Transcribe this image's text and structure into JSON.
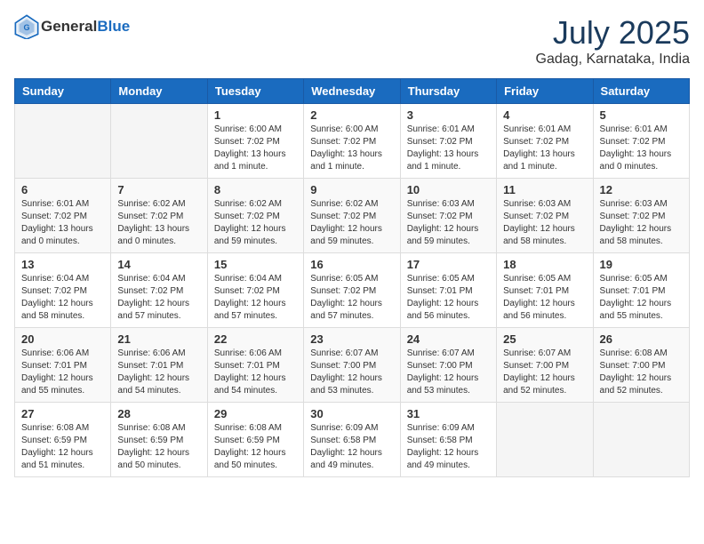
{
  "header": {
    "logo_general": "General",
    "logo_blue": "Blue",
    "month_year": "July 2025",
    "location": "Gadag, Karnataka, India"
  },
  "weekdays": [
    "Sunday",
    "Monday",
    "Tuesday",
    "Wednesday",
    "Thursday",
    "Friday",
    "Saturday"
  ],
  "weeks": [
    [
      {
        "day": "",
        "empty": true
      },
      {
        "day": "",
        "empty": true
      },
      {
        "day": "1",
        "sunrise": "Sunrise: 6:00 AM",
        "sunset": "Sunset: 7:02 PM",
        "daylight": "Daylight: 13 hours and 1 minute."
      },
      {
        "day": "2",
        "sunrise": "Sunrise: 6:00 AM",
        "sunset": "Sunset: 7:02 PM",
        "daylight": "Daylight: 13 hours and 1 minute."
      },
      {
        "day": "3",
        "sunrise": "Sunrise: 6:01 AM",
        "sunset": "Sunset: 7:02 PM",
        "daylight": "Daylight: 13 hours and 1 minute."
      },
      {
        "day": "4",
        "sunrise": "Sunrise: 6:01 AM",
        "sunset": "Sunset: 7:02 PM",
        "daylight": "Daylight: 13 hours and 1 minute."
      },
      {
        "day": "5",
        "sunrise": "Sunrise: 6:01 AM",
        "sunset": "Sunset: 7:02 PM",
        "daylight": "Daylight: 13 hours and 0 minutes."
      }
    ],
    [
      {
        "day": "6",
        "sunrise": "Sunrise: 6:01 AM",
        "sunset": "Sunset: 7:02 PM",
        "daylight": "Daylight: 13 hours and 0 minutes."
      },
      {
        "day": "7",
        "sunrise": "Sunrise: 6:02 AM",
        "sunset": "Sunset: 7:02 PM",
        "daylight": "Daylight: 13 hours and 0 minutes."
      },
      {
        "day": "8",
        "sunrise": "Sunrise: 6:02 AM",
        "sunset": "Sunset: 7:02 PM",
        "daylight": "Daylight: 12 hours and 59 minutes."
      },
      {
        "day": "9",
        "sunrise": "Sunrise: 6:02 AM",
        "sunset": "Sunset: 7:02 PM",
        "daylight": "Daylight: 12 hours and 59 minutes."
      },
      {
        "day": "10",
        "sunrise": "Sunrise: 6:03 AM",
        "sunset": "Sunset: 7:02 PM",
        "daylight": "Daylight: 12 hours and 59 minutes."
      },
      {
        "day": "11",
        "sunrise": "Sunrise: 6:03 AM",
        "sunset": "Sunset: 7:02 PM",
        "daylight": "Daylight: 12 hours and 58 minutes."
      },
      {
        "day": "12",
        "sunrise": "Sunrise: 6:03 AM",
        "sunset": "Sunset: 7:02 PM",
        "daylight": "Daylight: 12 hours and 58 minutes."
      }
    ],
    [
      {
        "day": "13",
        "sunrise": "Sunrise: 6:04 AM",
        "sunset": "Sunset: 7:02 PM",
        "daylight": "Daylight: 12 hours and 58 minutes."
      },
      {
        "day": "14",
        "sunrise": "Sunrise: 6:04 AM",
        "sunset": "Sunset: 7:02 PM",
        "daylight": "Daylight: 12 hours and 57 minutes."
      },
      {
        "day": "15",
        "sunrise": "Sunrise: 6:04 AM",
        "sunset": "Sunset: 7:02 PM",
        "daylight": "Daylight: 12 hours and 57 minutes."
      },
      {
        "day": "16",
        "sunrise": "Sunrise: 6:05 AM",
        "sunset": "Sunset: 7:02 PM",
        "daylight": "Daylight: 12 hours and 57 minutes."
      },
      {
        "day": "17",
        "sunrise": "Sunrise: 6:05 AM",
        "sunset": "Sunset: 7:01 PM",
        "daylight": "Daylight: 12 hours and 56 minutes."
      },
      {
        "day": "18",
        "sunrise": "Sunrise: 6:05 AM",
        "sunset": "Sunset: 7:01 PM",
        "daylight": "Daylight: 12 hours and 56 minutes."
      },
      {
        "day": "19",
        "sunrise": "Sunrise: 6:05 AM",
        "sunset": "Sunset: 7:01 PM",
        "daylight": "Daylight: 12 hours and 55 minutes."
      }
    ],
    [
      {
        "day": "20",
        "sunrise": "Sunrise: 6:06 AM",
        "sunset": "Sunset: 7:01 PM",
        "daylight": "Daylight: 12 hours and 55 minutes."
      },
      {
        "day": "21",
        "sunrise": "Sunrise: 6:06 AM",
        "sunset": "Sunset: 7:01 PM",
        "daylight": "Daylight: 12 hours and 54 minutes."
      },
      {
        "day": "22",
        "sunrise": "Sunrise: 6:06 AM",
        "sunset": "Sunset: 7:01 PM",
        "daylight": "Daylight: 12 hours and 54 minutes."
      },
      {
        "day": "23",
        "sunrise": "Sunrise: 6:07 AM",
        "sunset": "Sunset: 7:00 PM",
        "daylight": "Daylight: 12 hours and 53 minutes."
      },
      {
        "day": "24",
        "sunrise": "Sunrise: 6:07 AM",
        "sunset": "Sunset: 7:00 PM",
        "daylight": "Daylight: 12 hours and 53 minutes."
      },
      {
        "day": "25",
        "sunrise": "Sunrise: 6:07 AM",
        "sunset": "Sunset: 7:00 PM",
        "daylight": "Daylight: 12 hours and 52 minutes."
      },
      {
        "day": "26",
        "sunrise": "Sunrise: 6:08 AM",
        "sunset": "Sunset: 7:00 PM",
        "daylight": "Daylight: 12 hours and 52 minutes."
      }
    ],
    [
      {
        "day": "27",
        "sunrise": "Sunrise: 6:08 AM",
        "sunset": "Sunset: 6:59 PM",
        "daylight": "Daylight: 12 hours and 51 minutes."
      },
      {
        "day": "28",
        "sunrise": "Sunrise: 6:08 AM",
        "sunset": "Sunset: 6:59 PM",
        "daylight": "Daylight: 12 hours and 50 minutes."
      },
      {
        "day": "29",
        "sunrise": "Sunrise: 6:08 AM",
        "sunset": "Sunset: 6:59 PM",
        "daylight": "Daylight: 12 hours and 50 minutes."
      },
      {
        "day": "30",
        "sunrise": "Sunrise: 6:09 AM",
        "sunset": "Sunset: 6:58 PM",
        "daylight": "Daylight: 12 hours and 49 minutes."
      },
      {
        "day": "31",
        "sunrise": "Sunrise: 6:09 AM",
        "sunset": "Sunset: 6:58 PM",
        "daylight": "Daylight: 12 hours and 49 minutes."
      },
      {
        "day": "",
        "empty": true
      },
      {
        "day": "",
        "empty": true
      }
    ]
  ]
}
